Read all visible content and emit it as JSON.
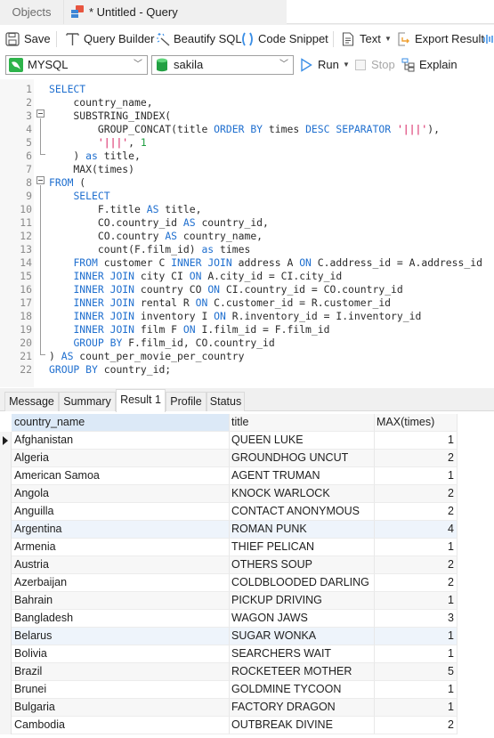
{
  "tabs": {
    "objects_label": "Objects",
    "query_label": "* Untitled - Query"
  },
  "toolbar": {
    "save": "Save",
    "query_builder": "Query Builder",
    "beautify_sql": "Beautify SQL",
    "code_snippet": "Code Snippet",
    "text": "Text",
    "export_result": "Export Result"
  },
  "connection_bar": {
    "connection": "MYSQL",
    "database": "sakila",
    "run": "Run",
    "stop": "Stop",
    "explain": "Explain"
  },
  "editor": {
    "line_numbers": [
      "1",
      "2",
      "3",
      "4",
      "5",
      "6",
      "7",
      "8",
      "9",
      "10",
      "11",
      "12",
      "13",
      "14",
      "15",
      "16",
      "17",
      "18",
      "19",
      "20",
      "21",
      "22"
    ],
    "lines": [
      [
        {
          "t": "kw",
          "v": "SELECT"
        }
      ],
      [
        {
          "t": "id",
          "v": "    country_name,"
        }
      ],
      [
        {
          "t": "id",
          "v": "    SUBSTRING_INDEX("
        }
      ],
      [
        {
          "t": "id",
          "v": "        GROUP_CONCAT(title "
        },
        {
          "t": "kw",
          "v": "ORDER BY"
        },
        {
          "t": "id",
          "v": " times "
        },
        {
          "t": "kw",
          "v": "DESC SEPARATOR"
        },
        {
          "t": "id",
          "v": " "
        },
        {
          "t": "str",
          "v": "'|||'"
        },
        {
          "t": "id",
          "v": "),"
        }
      ],
      [
        {
          "t": "id",
          "v": "        "
        },
        {
          "t": "str",
          "v": "'|||'"
        },
        {
          "t": "id",
          "v": ", "
        },
        {
          "t": "num",
          "v": "1"
        }
      ],
      [
        {
          "t": "id",
          "v": "    ) "
        },
        {
          "t": "kw",
          "v": "as"
        },
        {
          "t": "id",
          "v": " title,"
        }
      ],
      [
        {
          "t": "id",
          "v": "    MAX(times)"
        }
      ],
      [
        {
          "t": "kw",
          "v": "FROM"
        },
        {
          "t": "id",
          "v": " ("
        }
      ],
      [
        {
          "t": "id",
          "v": "    "
        },
        {
          "t": "kw",
          "v": "SELECT"
        }
      ],
      [
        {
          "t": "id",
          "v": "        F.title "
        },
        {
          "t": "kw",
          "v": "AS"
        },
        {
          "t": "id",
          "v": " title,"
        }
      ],
      [
        {
          "t": "id",
          "v": "        CO.country_id "
        },
        {
          "t": "kw",
          "v": "AS"
        },
        {
          "t": "id",
          "v": " country_id,"
        }
      ],
      [
        {
          "t": "id",
          "v": "        CO.country "
        },
        {
          "t": "kw",
          "v": "AS"
        },
        {
          "t": "id",
          "v": " country_name,"
        }
      ],
      [
        {
          "t": "id",
          "v": "        count(F.film_id) "
        },
        {
          "t": "kw",
          "v": "as"
        },
        {
          "t": "id",
          "v": " times"
        }
      ],
      [
        {
          "t": "id",
          "v": "    "
        },
        {
          "t": "kw",
          "v": "FROM"
        },
        {
          "t": "id",
          "v": " customer C "
        },
        {
          "t": "kw",
          "v": "INNER JOIN"
        },
        {
          "t": "id",
          "v": " address A "
        },
        {
          "t": "kw",
          "v": "ON"
        },
        {
          "t": "id",
          "v": " C.address_id = A.address_id"
        }
      ],
      [
        {
          "t": "id",
          "v": "    "
        },
        {
          "t": "kw",
          "v": "INNER JOIN"
        },
        {
          "t": "id",
          "v": " city CI "
        },
        {
          "t": "kw",
          "v": "ON"
        },
        {
          "t": "id",
          "v": " A.city_id = CI.city_id"
        }
      ],
      [
        {
          "t": "id",
          "v": "    "
        },
        {
          "t": "kw",
          "v": "INNER JOIN"
        },
        {
          "t": "id",
          "v": " country CO "
        },
        {
          "t": "kw",
          "v": "ON"
        },
        {
          "t": "id",
          "v": " CI.country_id = CO.country_id"
        }
      ],
      [
        {
          "t": "id",
          "v": "    "
        },
        {
          "t": "kw",
          "v": "INNER JOIN"
        },
        {
          "t": "id",
          "v": " rental R "
        },
        {
          "t": "kw",
          "v": "ON"
        },
        {
          "t": "id",
          "v": " C.customer_id = R.customer_id"
        }
      ],
      [
        {
          "t": "id",
          "v": "    "
        },
        {
          "t": "kw",
          "v": "INNER JOIN"
        },
        {
          "t": "id",
          "v": " inventory I "
        },
        {
          "t": "kw",
          "v": "ON"
        },
        {
          "t": "id",
          "v": " R.inventory_id = I.inventory_id"
        }
      ],
      [
        {
          "t": "id",
          "v": "    "
        },
        {
          "t": "kw",
          "v": "INNER JOIN"
        },
        {
          "t": "id",
          "v": " film F "
        },
        {
          "t": "kw",
          "v": "ON"
        },
        {
          "t": "id",
          "v": " I.film_id = F.film_id"
        }
      ],
      [
        {
          "t": "id",
          "v": "    "
        },
        {
          "t": "kw",
          "v": "GROUP BY"
        },
        {
          "t": "id",
          "v": " F.film_id, CO.country_id"
        }
      ],
      [
        {
          "t": "id",
          "v": ") "
        },
        {
          "t": "kw",
          "v": "AS"
        },
        {
          "t": "id",
          "v": " count_per_movie_per_country"
        }
      ],
      [
        {
          "t": "kw",
          "v": "GROUP BY"
        },
        {
          "t": "id",
          "v": " country_id;"
        }
      ]
    ]
  },
  "result_tabs": [
    "Message",
    "Summary",
    "Result 1",
    "Profile",
    "Status"
  ],
  "active_result_tab": "Result 1",
  "result_grid": {
    "columns": [
      "country_name",
      "title",
      "MAX(times)"
    ],
    "rows": [
      [
        "Afghanistan",
        "QUEEN LUKE",
        "1"
      ],
      [
        "Algeria",
        "GROUNDHOG UNCUT",
        "2"
      ],
      [
        "American Samoa",
        "AGENT TRUMAN",
        "1"
      ],
      [
        "Angola",
        "KNOCK WARLOCK",
        "2"
      ],
      [
        "Anguilla",
        "CONTACT ANONYMOUS",
        "2"
      ],
      [
        "Argentina",
        "ROMAN PUNK",
        "4"
      ],
      [
        "Armenia",
        "THIEF PELICAN",
        "1"
      ],
      [
        "Austria",
        "OTHERS SOUP",
        "2"
      ],
      [
        "Azerbaijan",
        "COLDBLOODED DARLING",
        "2"
      ],
      [
        "Bahrain",
        "PICKUP DRIVING",
        "1"
      ],
      [
        "Bangladesh",
        "WAGON JAWS",
        "3"
      ],
      [
        "Belarus",
        "SUGAR WONKA",
        "1"
      ],
      [
        "Bolivia",
        "SEARCHERS WAIT",
        "1"
      ],
      [
        "Brazil",
        "ROCKETEER MOTHER",
        "5"
      ],
      [
        "Brunei",
        "GOLDMINE TYCOON",
        "1"
      ],
      [
        "Bulgaria",
        "FACTORY DRAGON",
        "1"
      ],
      [
        "Cambodia",
        "OUTBREAK DIVINE",
        "2"
      ]
    ],
    "current_row": 0,
    "highlighted_rows": [
      5,
      11
    ]
  },
  "colors": {
    "keyword": "#1f6fcf",
    "string": "#d6185a",
    "number": "#1e9e40",
    "header_selected": "#dce9f7",
    "accent": "#3a8ee6"
  }
}
